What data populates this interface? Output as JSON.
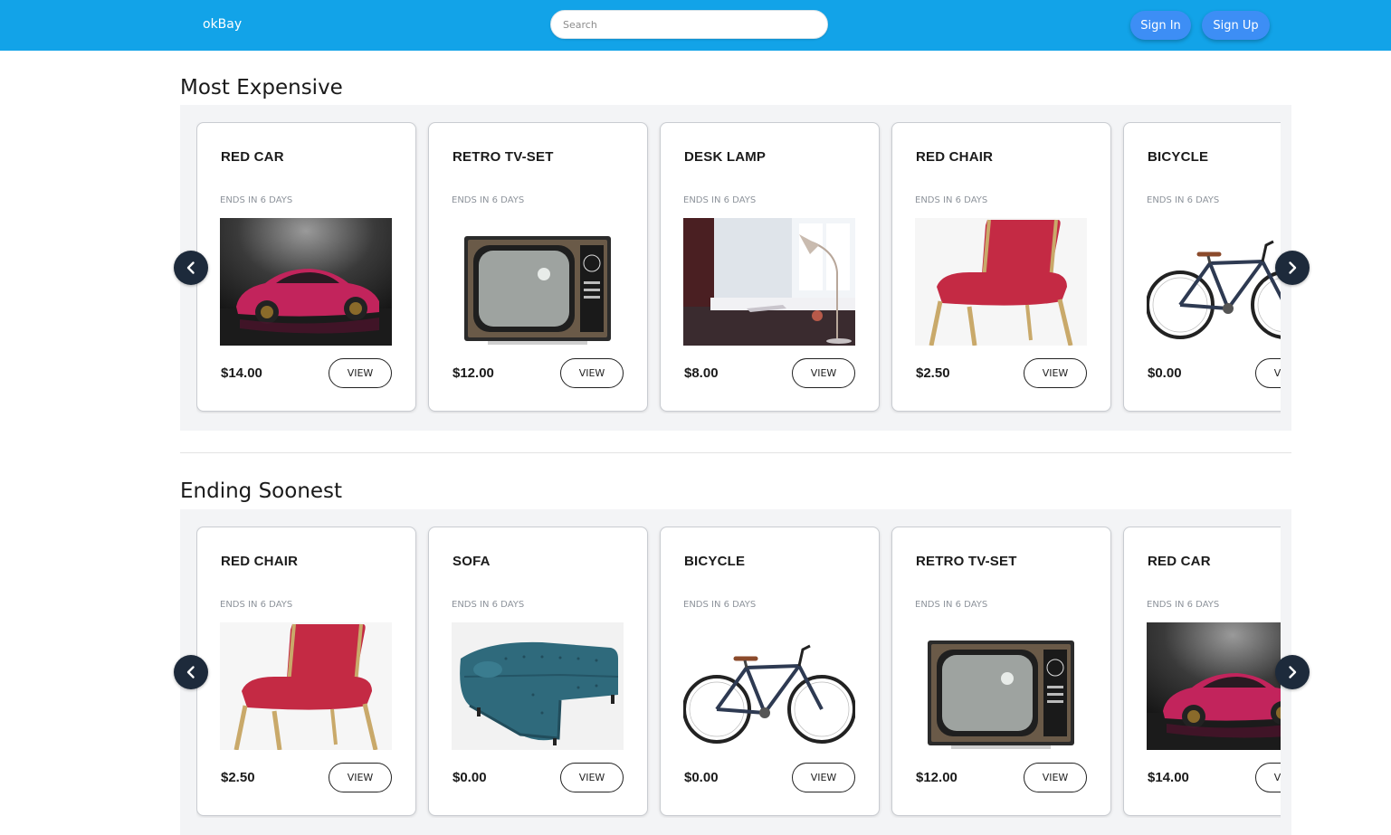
{
  "navbar": {
    "brand": "okBay",
    "search_placeholder": "Search",
    "sign_in": "Sign In",
    "sign_up": "Sign Up",
    "background": "#12a3e8",
    "button_color": "#3d8ef5"
  },
  "sections": [
    {
      "title": "Most Expensive",
      "prev_icon": "chevron-left-icon",
      "next_icon": "chevron-right-icon",
      "items": [
        {
          "name": "RED CAR",
          "ends": "ENDS IN 6 DAYS",
          "price": "$14.00",
          "view": "VIEW",
          "image": "car"
        },
        {
          "name": "RETRO TV-SET",
          "ends": "ENDS IN 6 DAYS",
          "price": "$12.00",
          "view": "VIEW",
          "image": "tv"
        },
        {
          "name": "DESK LAMP",
          "ends": "ENDS IN 6 DAYS",
          "price": "$8.00",
          "view": "VIEW",
          "image": "lamp"
        },
        {
          "name": "RED CHAIR",
          "ends": "ENDS IN 6 DAYS",
          "price": "$2.50",
          "view": "VIEW",
          "image": "chair"
        },
        {
          "name": "BICYCLE",
          "ends": "ENDS IN 6 DAYS",
          "price": "$0.00",
          "view": "VIEW",
          "image": "bicycle"
        }
      ]
    },
    {
      "title": "Ending Soonest",
      "prev_icon": "chevron-left-icon",
      "next_icon": "chevron-right-icon",
      "items": [
        {
          "name": "RED CHAIR",
          "ends": "ENDS IN 6 DAYS",
          "price": "$2.50",
          "view": "VIEW",
          "image": "chair"
        },
        {
          "name": "SOFA",
          "ends": "ENDS IN 6 DAYS",
          "price": "$0.00",
          "view": "VIEW",
          "image": "sofa"
        },
        {
          "name": "BICYCLE",
          "ends": "ENDS IN 6 DAYS",
          "price": "$0.00",
          "view": "VIEW",
          "image": "bicycle"
        },
        {
          "name": "RETRO TV-SET",
          "ends": "ENDS IN 6 DAYS",
          "price": "$12.00",
          "view": "VIEW",
          "image": "tv"
        },
        {
          "name": "RED CAR",
          "ends": "ENDS IN 6 DAYS",
          "price": "$14.00",
          "view": "VIEW",
          "image": "car"
        }
      ]
    }
  ]
}
